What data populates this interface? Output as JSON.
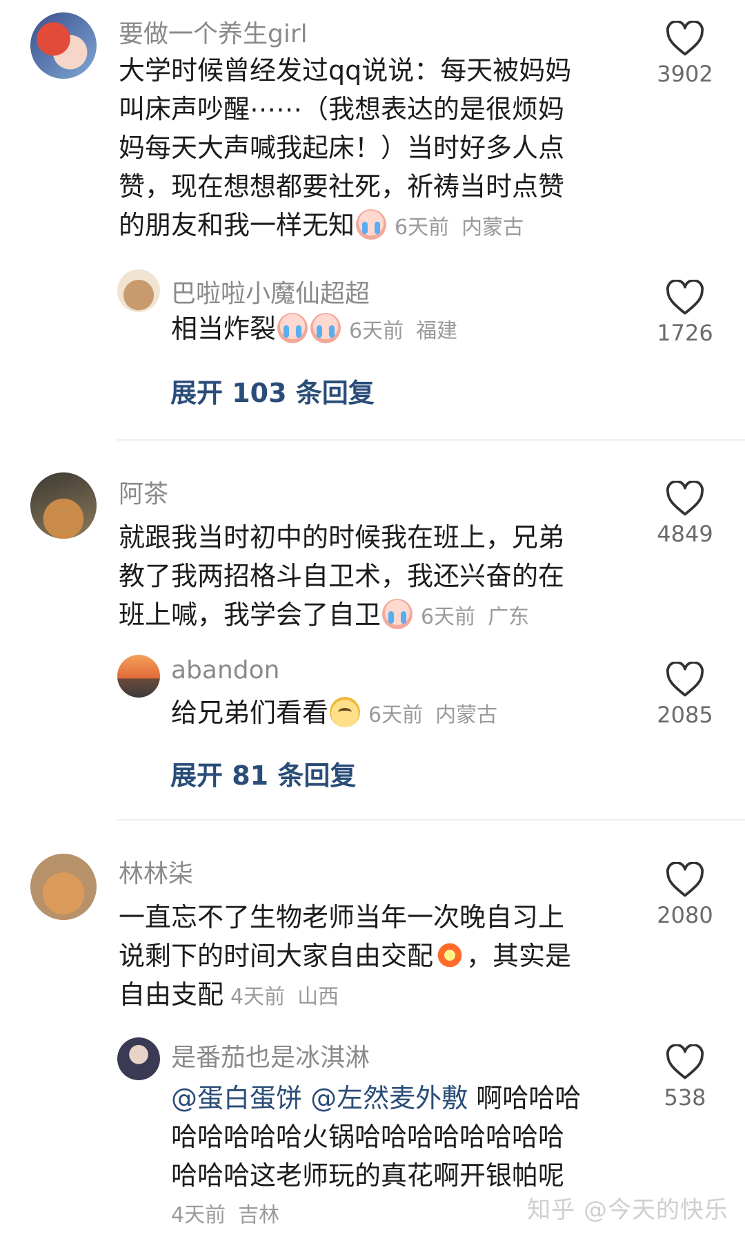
{
  "comments": [
    {
      "user": "要做一个养生girl",
      "lines": [
        "大学时候曾经发过qq说说：每天被妈妈",
        "叫床声吵醒⋯⋯（我想表达的是很烦妈",
        "妈每天大声喊我起床！）当时好多人点",
        "赞，现在想想都要社死，祈祷当时点赞",
        "的朋友和我一样无知"
      ],
      "time": "6天前",
      "location": "内蒙古",
      "likes": "3902",
      "reply": {
        "user": "巴啦啦小魔仙超超",
        "text": "相当炸裂",
        "time": "6天前",
        "location": "福建",
        "likes": "1726"
      },
      "expand": "展开 103 条回复"
    },
    {
      "user": "阿茶",
      "lines": [
        "就跟我当时初中的时候我在班上，兄弟",
        "教了我两招格斗自卫术，我还兴奋的在",
        "班上喊，我学会了自卫"
      ],
      "time": "6天前",
      "location": "广东",
      "likes": "4849",
      "reply": {
        "user": "abandon",
        "text": "给兄弟们看看",
        "time": "6天前",
        "location": "内蒙古",
        "likes": "2085"
      },
      "expand": "展开 81 条回复"
    },
    {
      "user": "林林柒",
      "lines": [
        "一直忘不了生物老师当年一次晚自习上",
        "说剩下的时间大家自由交配",
        "，其实是",
        "自由支配"
      ],
      "time": "4天前",
      "location": "山西",
      "likes": "2080",
      "reply": {
        "user": "是番茄也是冰淇淋",
        "mention1": "@蛋白蛋饼",
        "mention2": "@左然麦外敷",
        "lines": [
          "啊哈哈哈",
          "哈哈哈哈哈火锅哈哈哈哈哈哈哈哈",
          "哈哈哈这老师玩的真花啊开银帕呢"
        ],
        "time": "4天前",
        "location": "吉林",
        "likes": "538"
      }
    }
  ],
  "watermark": "知乎 @今天的快乐",
  "icons": {
    "like": "heart-outline-icon"
  },
  "colors": {
    "link": "#2a4d78",
    "muted": "#9a9a9a"
  }
}
